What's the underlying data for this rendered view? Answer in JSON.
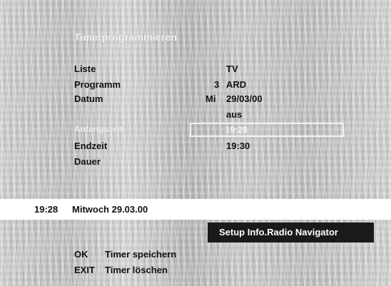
{
  "menu": {
    "title": "Timerprogrammieren",
    "rows": [
      {
        "label": "Liste",
        "value": "TV"
      },
      {
        "label": "Programm",
        "channel_number": "3",
        "value": "ARD"
      },
      {
        "label": "Datum",
        "day": "Mi",
        "value": "29/03/00"
      },
      {
        "label": "",
        "value": "aus"
      },
      {
        "label": "Anfangszeit",
        "value": "19:28"
      },
      {
        "label": "Endzeit",
        "value": "19:30"
      },
      {
        "label": "Dauer",
        "value": ""
      }
    ]
  },
  "statusbar": {
    "time": "19:28",
    "date": "Mitwoch 29.03.00"
  },
  "nav_button": {
    "label": "Setup Info.Radio Navigator"
  },
  "footer": {
    "ok_key": "OK",
    "ok_action": "Timer speichern",
    "exit_key": "EXIT",
    "exit_action": "Timer löschen"
  },
  "colors": {
    "highlight": "#f2f2f2",
    "nav_bg": "#1a1a1a"
  }
}
